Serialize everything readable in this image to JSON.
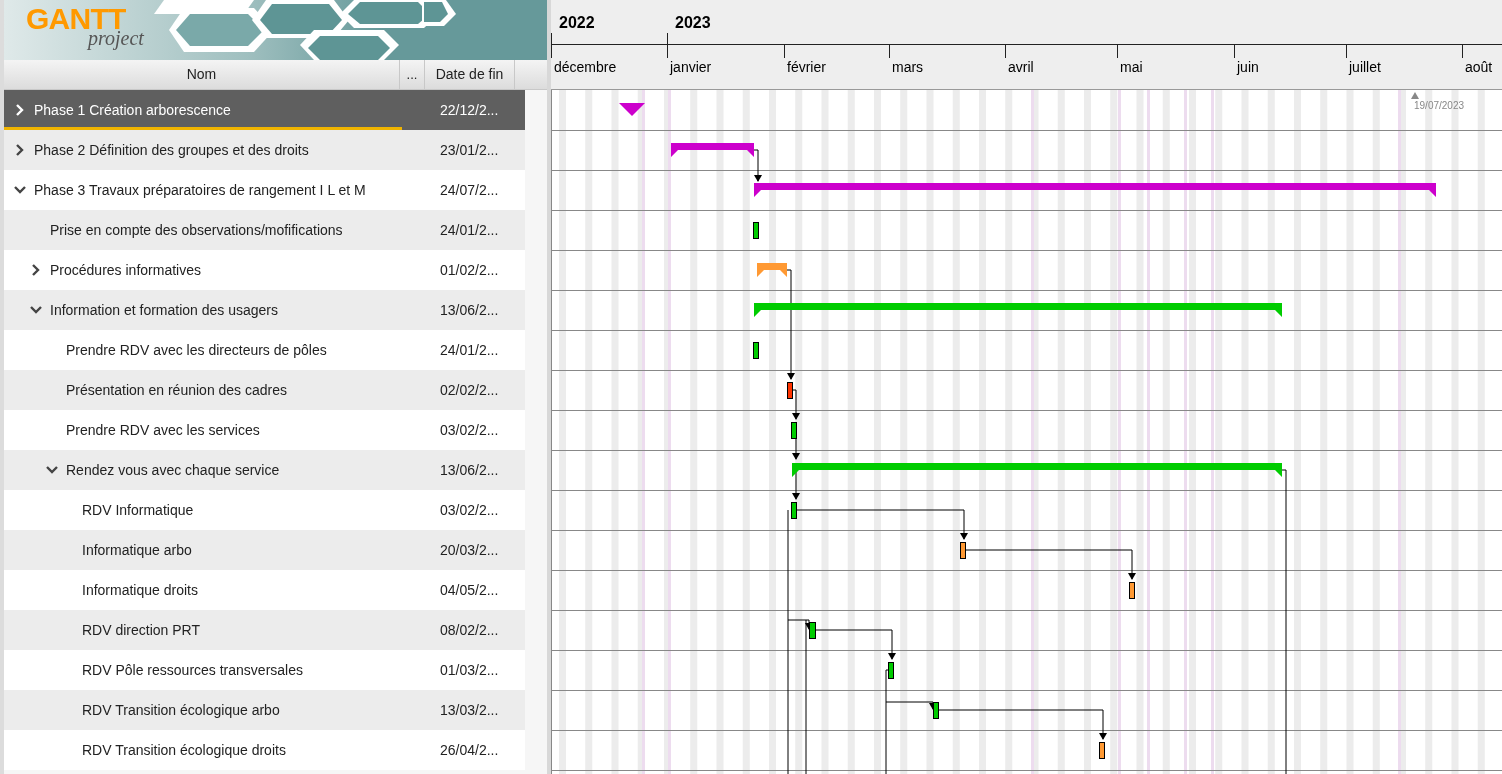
{
  "logo": {
    "word": "GANTT",
    "subword": "project"
  },
  "table": {
    "columns": [
      "Nom",
      "...",
      "Date de fin"
    ],
    "tasks": [
      {
        "name": "Phase 1 Création arborescence",
        "end": "22/12/2...",
        "kind": "milestone",
        "color": "#cc00cc",
        "expanded": false,
        "selected": true
      },
      {
        "name": "Phase 2 Définition des groupes et des droits",
        "end": "23/01/2...",
        "kind": "summary",
        "color": "#cc00cc",
        "expanded": false,
        "selected": false
      },
      {
        "name": "Phase 3 Travaux préparatoires de rangement I L et M",
        "end": "24/07/2...",
        "kind": "summary",
        "color": "#cc00cc",
        "expanded": true,
        "selected": false,
        "children": [
          {
            "name": "Prise en compte des observations/mofifications",
            "end": "24/01/2...",
            "kind": "task",
            "color": "#00cc00",
            "selected": false
          },
          {
            "name": "Procédures informatives",
            "end": "01/02/2...",
            "kind": "summary",
            "color": "#ff9933",
            "expanded": false,
            "selected": false
          },
          {
            "name": "Information et formation des usagers",
            "end": "13/06/2...",
            "kind": "summary",
            "color": "#00cc00",
            "expanded": true,
            "selected": false,
            "children": [
              {
                "name": "Prendre RDV avec les directeurs de pôles",
                "end": "24/01/2...",
                "kind": "task",
                "color": "#00cc00",
                "selected": false
              },
              {
                "name": "Présentation en réunion des cadres",
                "end": "02/02/2...",
                "kind": "task",
                "color": "#ff3300",
                "selected": false
              },
              {
                "name": "Prendre RDV avec les services",
                "end": "03/02/2...",
                "kind": "task",
                "color": "#00cc00",
                "selected": false
              },
              {
                "name": "Rendez vous avec chaque service",
                "end": "13/06/2...",
                "kind": "summary",
                "color": "#00cc00",
                "expanded": true,
                "selected": false,
                "children": [
                  {
                    "name": "RDV Informatique",
                    "end": "03/02/2...",
                    "kind": "task",
                    "color": "#00cc00",
                    "selected": false
                  },
                  {
                    "name": "Informatique arbo",
                    "end": "20/03/2...",
                    "kind": "task",
                    "color": "#ff9933",
                    "selected": false
                  },
                  {
                    "name": "Informatique droits",
                    "end": "04/05/2...",
                    "kind": "task",
                    "color": "#ff9933",
                    "selected": false
                  },
                  {
                    "name": "RDV direction PRT",
                    "end": "08/02/2...",
                    "kind": "task",
                    "color": "#00cc00",
                    "selected": false
                  },
                  {
                    "name": "RDV Pôle ressources transversales",
                    "end": "01/03/2...",
                    "kind": "task",
                    "color": "#00cc00",
                    "selected": false
                  },
                  {
                    "name": "RDV Transition écologique arbo",
                    "end": "13/03/2...",
                    "kind": "task",
                    "color": "#00cc00",
                    "selected": false
                  },
                  {
                    "name": "RDV Transition écologique droits",
                    "end": "26/04/2...",
                    "kind": "task",
                    "color": "#ff9933",
                    "selected": false
                  }
                ]
              }
            ]
          }
        ]
      }
    ]
  },
  "timeline": {
    "years": [
      "2022",
      "2023"
    ],
    "months": [
      "décembre",
      "janvier",
      "février",
      "mars",
      "avril",
      "mai",
      "juin",
      "juillet",
      "août"
    ],
    "today_label": "19/07/2023"
  }
}
